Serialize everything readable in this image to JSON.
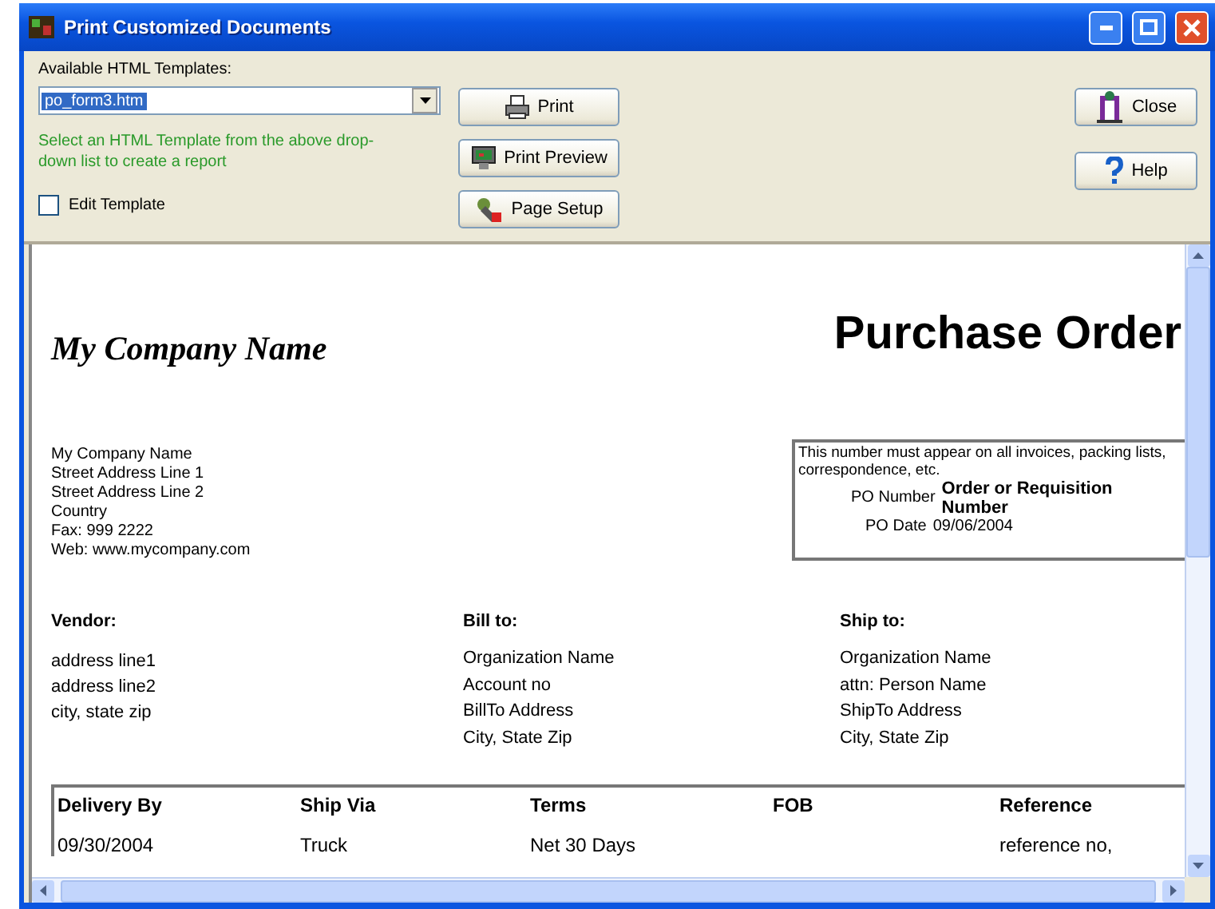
{
  "window": {
    "title": "Print Customized Documents"
  },
  "toolbar": {
    "templates_label": "Available HTML Templates:",
    "template_select": {
      "value": "po_form3.htm",
      "selected": true
    },
    "hint": "Select an HTML Template from the above drop-down list to create a report",
    "edit_template": {
      "label": "Edit Template",
      "checked": false
    },
    "actions": [
      {
        "label": "Print",
        "kind": "print"
      },
      {
        "label": "Print Preview",
        "kind": "preview"
      },
      {
        "label": "Page Setup",
        "kind": "setup"
      }
    ],
    "side_actions": [
      {
        "label": "Close",
        "kind": "close"
      },
      {
        "label": "Help",
        "kind": "help"
      }
    ]
  },
  "document": {
    "company_name": "My Company Name",
    "doc_title": "Purchase Order",
    "company_address": [
      "My Company Name",
      "Street Address Line 1",
      "Street Address Line 2",
      "Country",
      "Fax: 999 2222",
      "Web: www.mycompany.com"
    ],
    "po_box": {
      "note": "This number must appear on all invoices, packing lists, correspondence, etc.",
      "po_number_label": "PO Number",
      "po_number_value": "Order or Requisition Number",
      "po_date_label": "PO Date",
      "po_date_value": "09/06/2004"
    },
    "parties": [
      {
        "heading": "Vendor:",
        "lines": [
          "address line1",
          "address line2",
          "city, state zip"
        ]
      },
      {
        "heading": "Bill to:",
        "lines": [
          "Organization Name",
          "Account no",
          "BillTo Address",
          "City, State Zip"
        ]
      },
      {
        "heading": "Ship to:",
        "lines": [
          "Organization Name",
          "attn: Person Name",
          "ShipTo Address",
          "City, State Zip"
        ]
      }
    ],
    "order_table": {
      "columns": [
        "Delivery By",
        "Ship Via",
        "Terms",
        "FOB",
        "Reference"
      ],
      "rows": [
        [
          "09/30/2004",
          "Truck",
          "Net 30 Days",
          "",
          "reference no,"
        ]
      ]
    }
  }
}
